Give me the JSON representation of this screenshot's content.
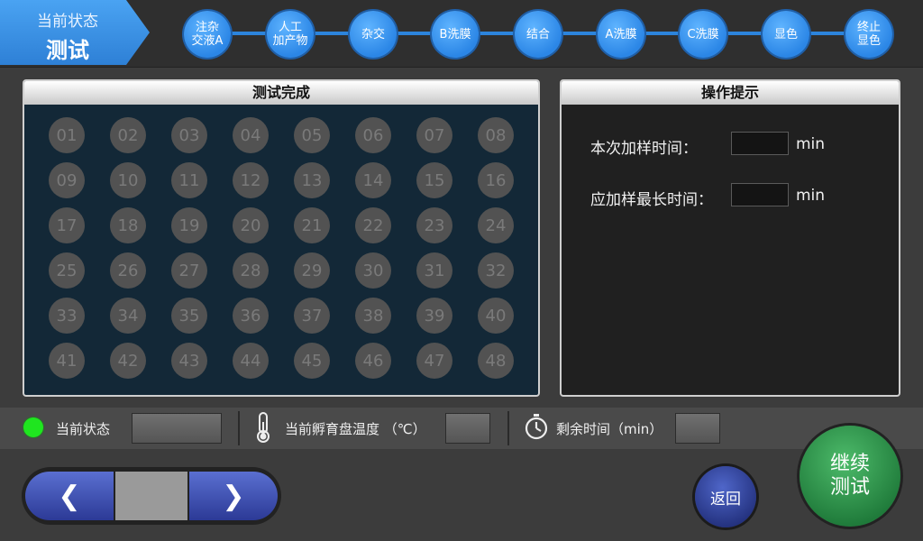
{
  "status_tab": {
    "line1": "当前状态",
    "line2": "测试"
  },
  "steps": [
    "注杂\n交液A",
    "人工\n加产物",
    "杂交",
    "B洗膜",
    "结合",
    "A洗膜",
    "C洗膜",
    "显色",
    "终止\n显色"
  ],
  "left_panel": {
    "title": "测试完成",
    "wells": [
      "01",
      "02",
      "03",
      "04",
      "05",
      "06",
      "07",
      "08",
      "09",
      "10",
      "11",
      "12",
      "13",
      "14",
      "15",
      "16",
      "17",
      "18",
      "19",
      "20",
      "21",
      "22",
      "23",
      "24",
      "25",
      "26",
      "27",
      "28",
      "29",
      "30",
      "31",
      "32",
      "33",
      "34",
      "35",
      "36",
      "37",
      "38",
      "39",
      "40",
      "41",
      "42",
      "43",
      "44",
      "45",
      "46",
      "47",
      "48"
    ]
  },
  "right_panel": {
    "title": "操作提示",
    "sample_time_label": "本次加样时间：",
    "sample_time_value": "",
    "sample_time_unit": "min",
    "max_time_label": "应加样最长时间：",
    "max_time_value": "",
    "max_time_unit": "min"
  },
  "status_bar": {
    "state_label": "当前状态",
    "state_value": "",
    "state_color": "#1fe51f",
    "temp_label": "当前孵育盘温度 （℃）",
    "temp_value": "",
    "remaining_label": "剩余时间（min）",
    "remaining_value": ""
  },
  "nav": {
    "prev": "❮",
    "next": "❯",
    "page": ""
  },
  "buttons": {
    "back": "返回",
    "continue": "继续\n测试"
  }
}
